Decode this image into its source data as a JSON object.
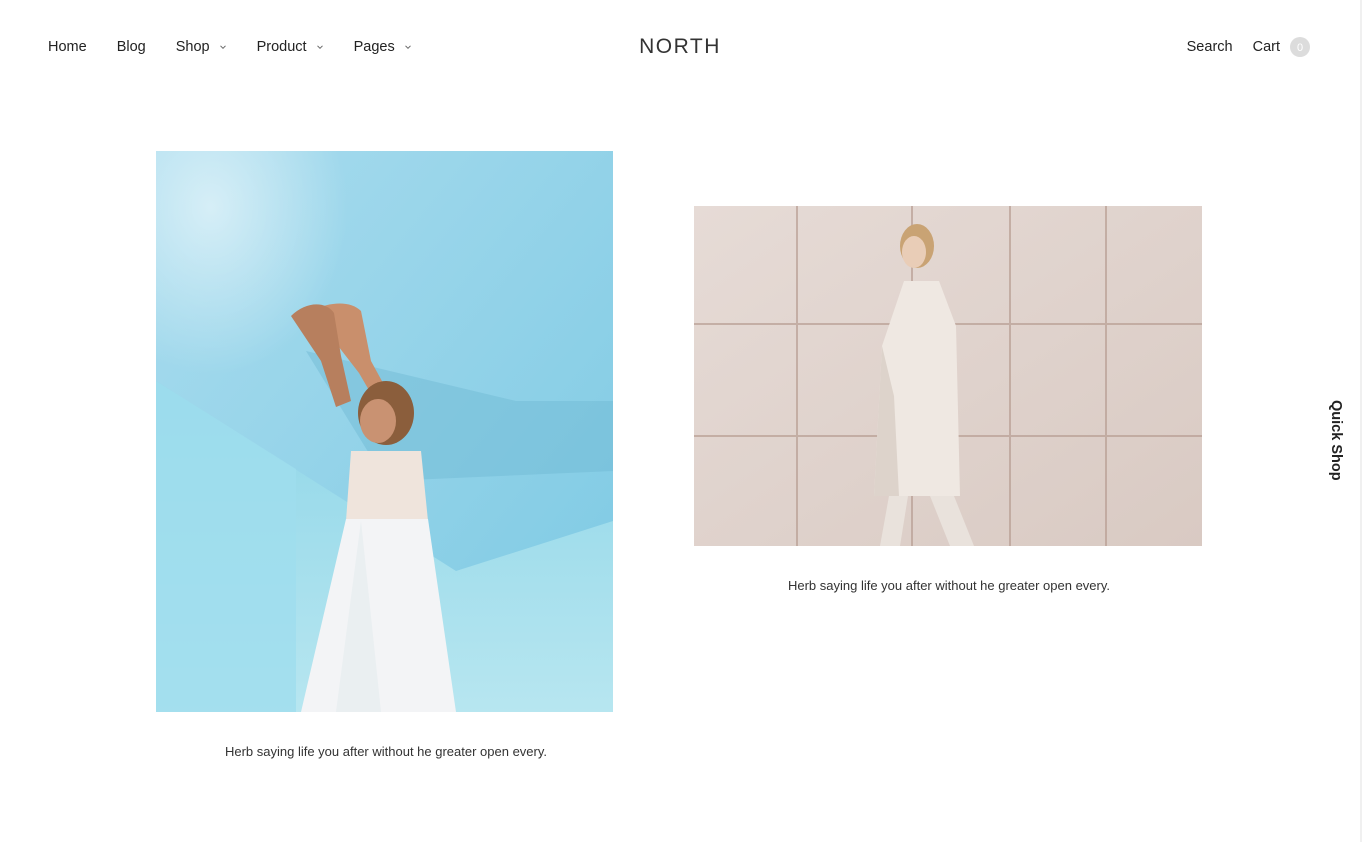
{
  "header": {
    "nav": [
      {
        "label": "Home",
        "has_dropdown": false
      },
      {
        "label": "Blog",
        "has_dropdown": false
      },
      {
        "label": "Shop",
        "has_dropdown": true
      },
      {
        "label": "Product",
        "has_dropdown": true
      },
      {
        "label": "Pages",
        "has_dropdown": true
      }
    ],
    "logo": "NORTH",
    "search_label": "Search",
    "cart_label": "Cart",
    "cart_count": "0"
  },
  "quick_shop_label": "Quick Shop",
  "gallery": [
    {
      "image": "woman-in-white-dress-blue-wall",
      "caption": "Herb saying life you after without he greater open every."
    },
    {
      "image": "woman-in-white-coat-walking",
      "caption": "Herb saying life you after without he greater open every."
    }
  ],
  "colors": {
    "text": "#222222",
    "cart_badge": "#dcdcdc",
    "sky_blue": "#8fd3e8"
  }
}
